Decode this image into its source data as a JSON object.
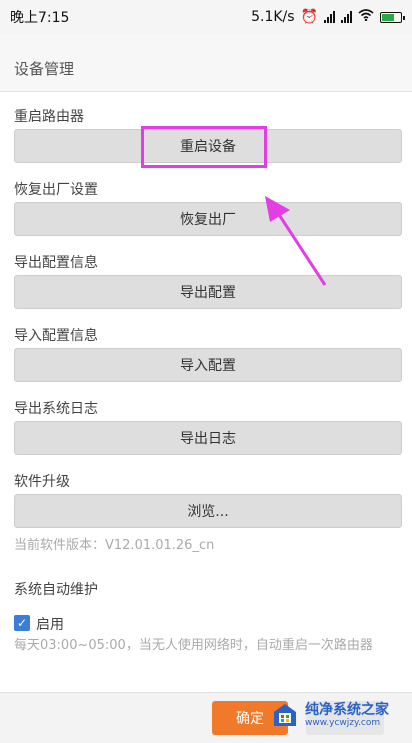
{
  "status_bar": {
    "time": "晚上7:15",
    "speed": "5.1K/s",
    "icons": [
      "alarm-icon",
      "signal-icon",
      "signal-icon",
      "wifi-icon",
      "battery-icon"
    ]
  },
  "header": {
    "title": "设备管理"
  },
  "sections": {
    "reboot": {
      "label": "重启路由器",
      "button": "重启设备"
    },
    "restore": {
      "label": "恢复出厂设置",
      "button": "恢复出厂"
    },
    "export_config": {
      "label": "导出配置信息",
      "button": "导出配置"
    },
    "import_config": {
      "label": "导入配置信息",
      "button": "导入配置"
    },
    "export_log": {
      "label": "导出系统日志",
      "button": "导出日志"
    },
    "upgrade": {
      "label": "软件升级",
      "button": "浏览...",
      "version": "当前软件版本：V12.01.01.26_cn"
    },
    "auto_maint": {
      "label": "系统自动维护",
      "checkbox_label": "启用",
      "checked": true,
      "hint": "每天03:00~05:00，当无人使用网络时，自动重启一次路由器"
    }
  },
  "footer": {
    "confirm": "确定"
  },
  "watermark": {
    "name": "纯净系统之家",
    "url": "www.ycwjzy.com"
  },
  "colors": {
    "highlight": "#e23ee3",
    "confirm": "#f07a2a",
    "checkbox": "#3b7dd8"
  }
}
